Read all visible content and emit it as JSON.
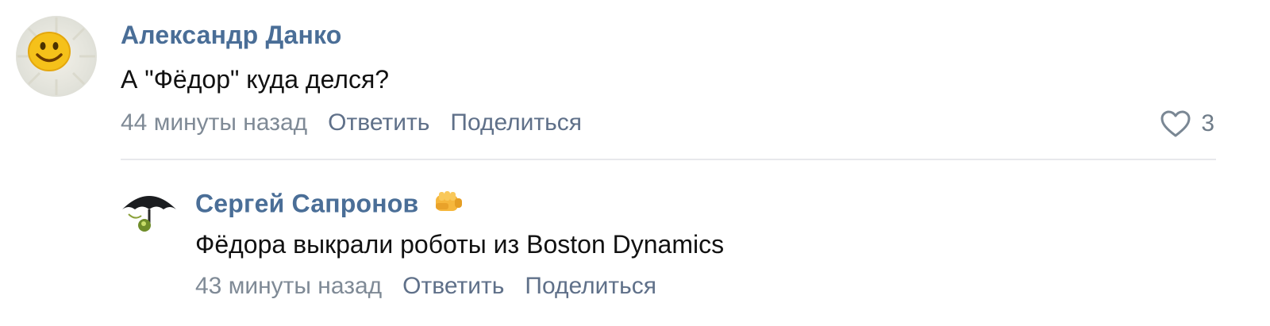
{
  "comments": [
    {
      "author": "Александр Данко",
      "text": "А \"Фёдор\" куда делся?",
      "time": "44 минуты назад",
      "reply_label": "Ответить",
      "share_label": "Поделиться",
      "likes": "3",
      "avatar_icon": "smiley-sun-avatar"
    }
  ],
  "replies": [
    {
      "author": "Сергей Сапронов",
      "badge_icon": "fist-emoji-icon",
      "text": "Фёдора выкрали роботы из Boston Dynamics",
      "time": "43 минуты назад",
      "reply_label": "Ответить",
      "share_label": "Поделиться",
      "avatar_icon": "umbrella-avatar"
    }
  ],
  "colors": {
    "author": "#4a6e97",
    "meta": "#7f8a96",
    "action": "#5f7089",
    "divider": "#e7e8ec"
  }
}
